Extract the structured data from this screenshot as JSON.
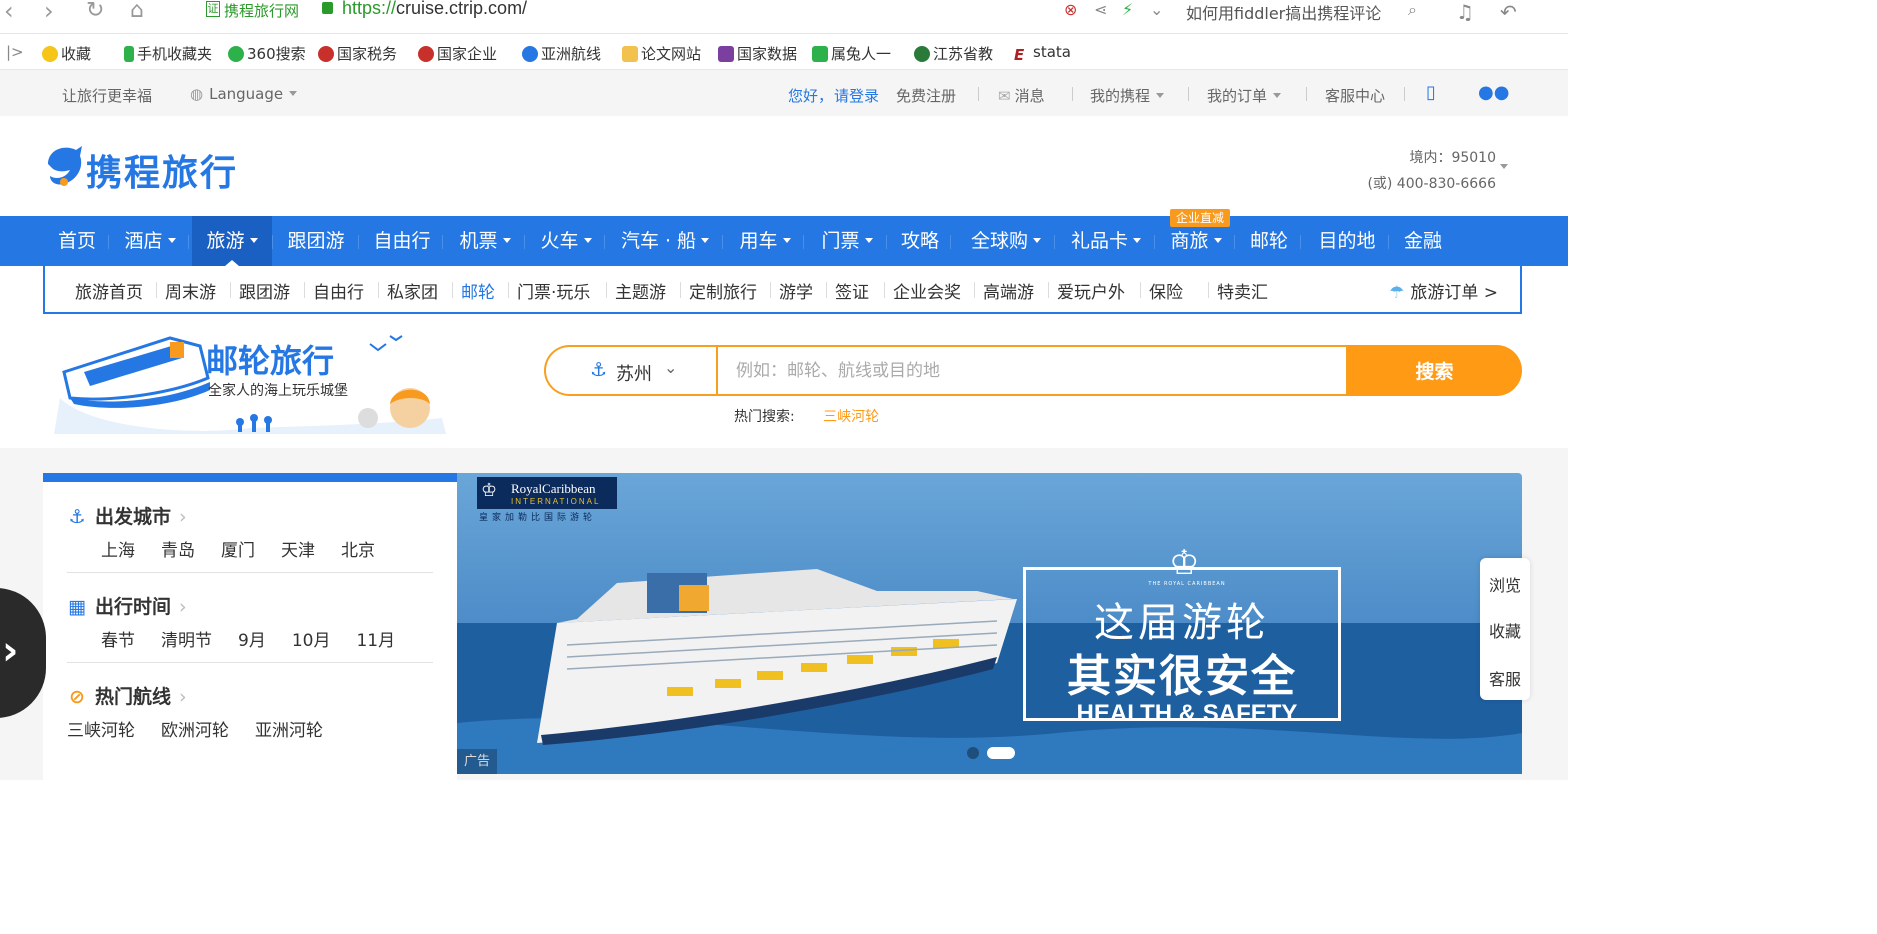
{
  "browser": {
    "site_name": "携程旅行网",
    "cert_label": "证",
    "url_scheme": "https://",
    "url_host": "cruise.ctrip.com/",
    "search_text": "如何用fiddler搞出携程评论"
  },
  "bookmarks": [
    {
      "label": "收藏",
      "icon": "star-icon",
      "color": "#f5c518"
    },
    {
      "label": "手机收藏夹",
      "icon": "phone-icon",
      "color": "#2db14a"
    },
    {
      "label": "360搜索",
      "icon": "search-360-icon",
      "color": "#2db14a"
    },
    {
      "label": "国家税务",
      "icon": "emblem-icon",
      "color": "#c8302c"
    },
    {
      "label": "国家企业",
      "icon": "emblem-icon",
      "color": "#c8302c"
    },
    {
      "label": "亚洲航线",
      "icon": "ctrip-icon",
      "color": "#2577e3"
    },
    {
      "label": "论文网站",
      "icon": "folder-icon",
      "color": "#f2c14e"
    },
    {
      "label": "国家数据",
      "icon": "shield-icon",
      "color": "#7b3fa0"
    },
    {
      "label": "属兔人一",
      "icon": "play-icon",
      "color": "#2db14a"
    },
    {
      "label": "江苏省教",
      "icon": "education-icon",
      "color": "#2a7a3a"
    },
    {
      "label": "stata",
      "icon": "stata-icon",
      "color": "#b02020"
    }
  ],
  "topbar": {
    "slogan": "让旅行更幸福",
    "language": "Language",
    "greeting": "您好，",
    "login": "请登录",
    "register": "免费注册",
    "messages": "消息",
    "my_trips": "我的携程",
    "my_orders": "我的订单",
    "service": "客服中心"
  },
  "header": {
    "logo_text": "携程旅行",
    "hotline_domestic": "境内：95010",
    "hotline_alt": "(或) 400-830-6666"
  },
  "mainnav": [
    {
      "label": "首页",
      "dropdown": false
    },
    {
      "label": "酒店",
      "dropdown": true
    },
    {
      "label": "旅游",
      "dropdown": true,
      "active": true
    },
    {
      "label": "跟团游",
      "dropdown": false
    },
    {
      "label": "自由行",
      "dropdown": false
    },
    {
      "label": "机票",
      "dropdown": true
    },
    {
      "label": "火车",
      "dropdown": true
    },
    {
      "label": "汽车 · 船",
      "dropdown": true
    },
    {
      "label": "用车",
      "dropdown": true
    },
    {
      "label": "门票",
      "dropdown": true
    },
    {
      "label": "攻略",
      "dropdown": false
    },
    {
      "label": "全球购",
      "dropdown": true
    },
    {
      "label": "礼品卡",
      "dropdown": true
    },
    {
      "label": "商旅",
      "dropdown": true
    },
    {
      "label": "邮轮",
      "dropdown": false
    },
    {
      "label": "目的地",
      "dropdown": false
    },
    {
      "label": "金融",
      "dropdown": false
    }
  ],
  "nav_badge": "企业直减",
  "subnav": {
    "items": [
      "旅游首页",
      "周末游",
      "跟团游",
      "自由行",
      "私家团",
      "邮轮",
      "门票·玩乐",
      "主题游",
      "定制旅行",
      "游学",
      "签证",
      "企业会奖",
      "高端游",
      "爱玩户外",
      "保险",
      "特卖汇"
    ],
    "active": "邮轮",
    "orders": "旅游订单 >"
  },
  "cruise": {
    "title": "邮轮旅行",
    "subtitle": "全家人的海上玩乐城堡"
  },
  "search": {
    "city": "苏州",
    "placeholder": "例如：邮轮、航线或目的地",
    "button": "搜索",
    "hot_label": "热门搜索:",
    "hot_item": "三峡河轮"
  },
  "filters": {
    "departure": {
      "title": "出发城市",
      "options": [
        "上海",
        "青岛",
        "厦门",
        "天津",
        "北京"
      ]
    },
    "time": {
      "title": "出行时间",
      "options": [
        "春节",
        "清明节",
        "9月",
        "10月",
        "11月"
      ]
    },
    "routes": {
      "title": "热门航线",
      "options": [
        "三峡河轮",
        "欧洲河轮",
        "亚洲河轮"
      ]
    }
  },
  "banner": {
    "brand": "RoyalCaribbean",
    "brand_sub": "INTERNATIONAL",
    "brand_cn": "皇家加勒比国际游轮",
    "line1": "这届游轮",
    "line2": "其实很安全",
    "line3": "HEALTH & SAFETY",
    "crown_caption": "THE ROYAL CARIBBEAN",
    "ad_tag": "广告"
  },
  "float_side": [
    "浏览",
    "收藏",
    "客服"
  ],
  "colors": {
    "brand_blue": "#2577e3",
    "accent_orange": "#ff9a14"
  }
}
